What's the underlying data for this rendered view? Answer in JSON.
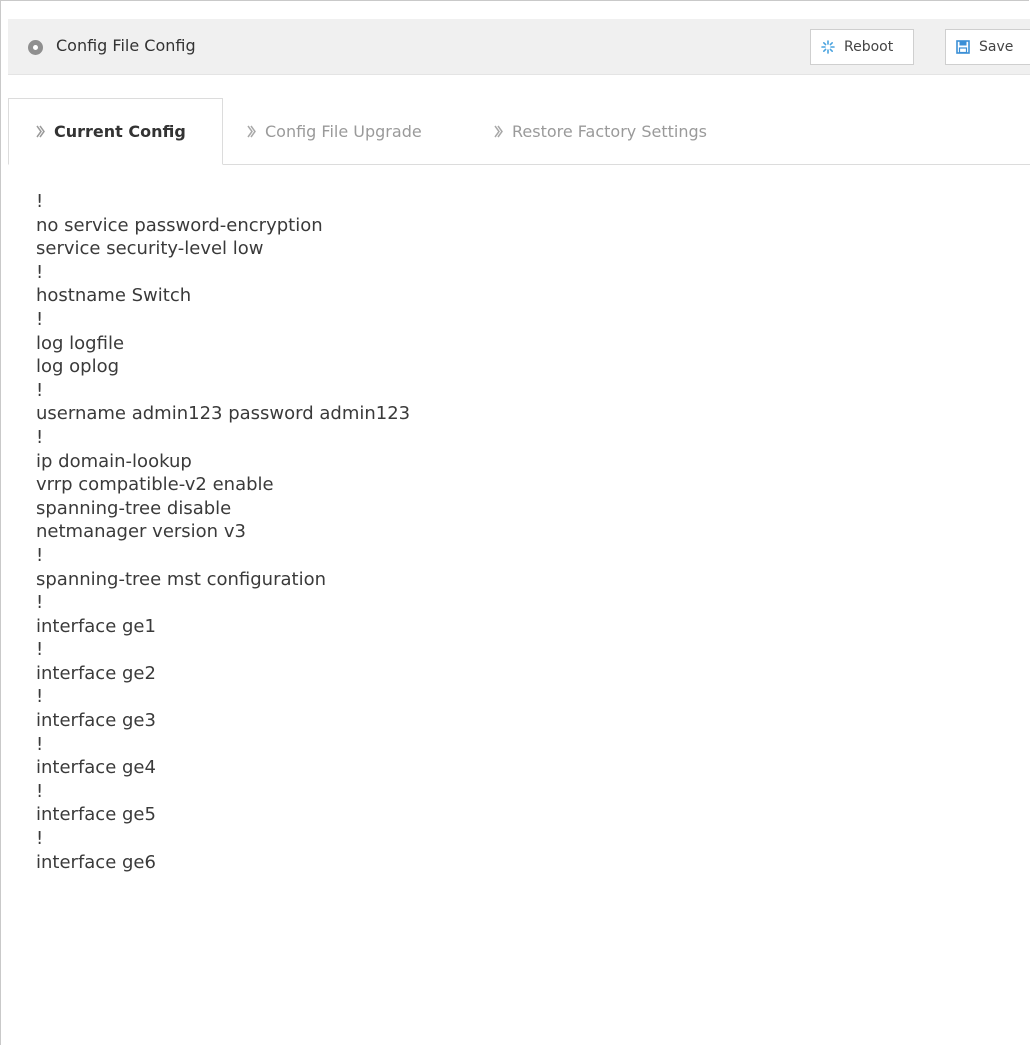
{
  "header": {
    "title": "Config File Config",
    "reboot_label": "Reboot",
    "save_label": "Save"
  },
  "tabs": [
    {
      "label": "Current Config",
      "active": true
    },
    {
      "label": "Config File Upgrade",
      "active": false
    },
    {
      "label": "Restore Factory Settings",
      "active": false
    }
  ],
  "config_lines": [
    "!",
    "no service password-encryption",
    "service security-level low",
    "!",
    "hostname Switch",
    "!",
    "log logfile",
    "log oplog",
    "!",
    "username admin123 password admin123",
    "!",
    "ip domain-lookup",
    "vrrp compatible-v2 enable",
    "spanning-tree disable",
    "netmanager version v3",
    "!",
    "spanning-tree mst configuration",
    "!",
    "interface ge1",
    "!",
    "interface ge2",
    "!",
    "interface ge3",
    "!",
    "interface ge4",
    "!",
    "interface ge5",
    "!",
    "interface ge6"
  ],
  "colors": {
    "titlebar_bg": "#f0f0f0",
    "accent_icon": "#3b8fd6",
    "reboot_icon": "#4aa3df",
    "text": "#3a3a3a",
    "inactive_tab": "#9a9a9a"
  },
  "icons": {
    "title": "circle-dot-icon",
    "reboot": "spinner-icon",
    "save": "floppy-disk-icon",
    "tab": "double-chevron-right-icon"
  }
}
